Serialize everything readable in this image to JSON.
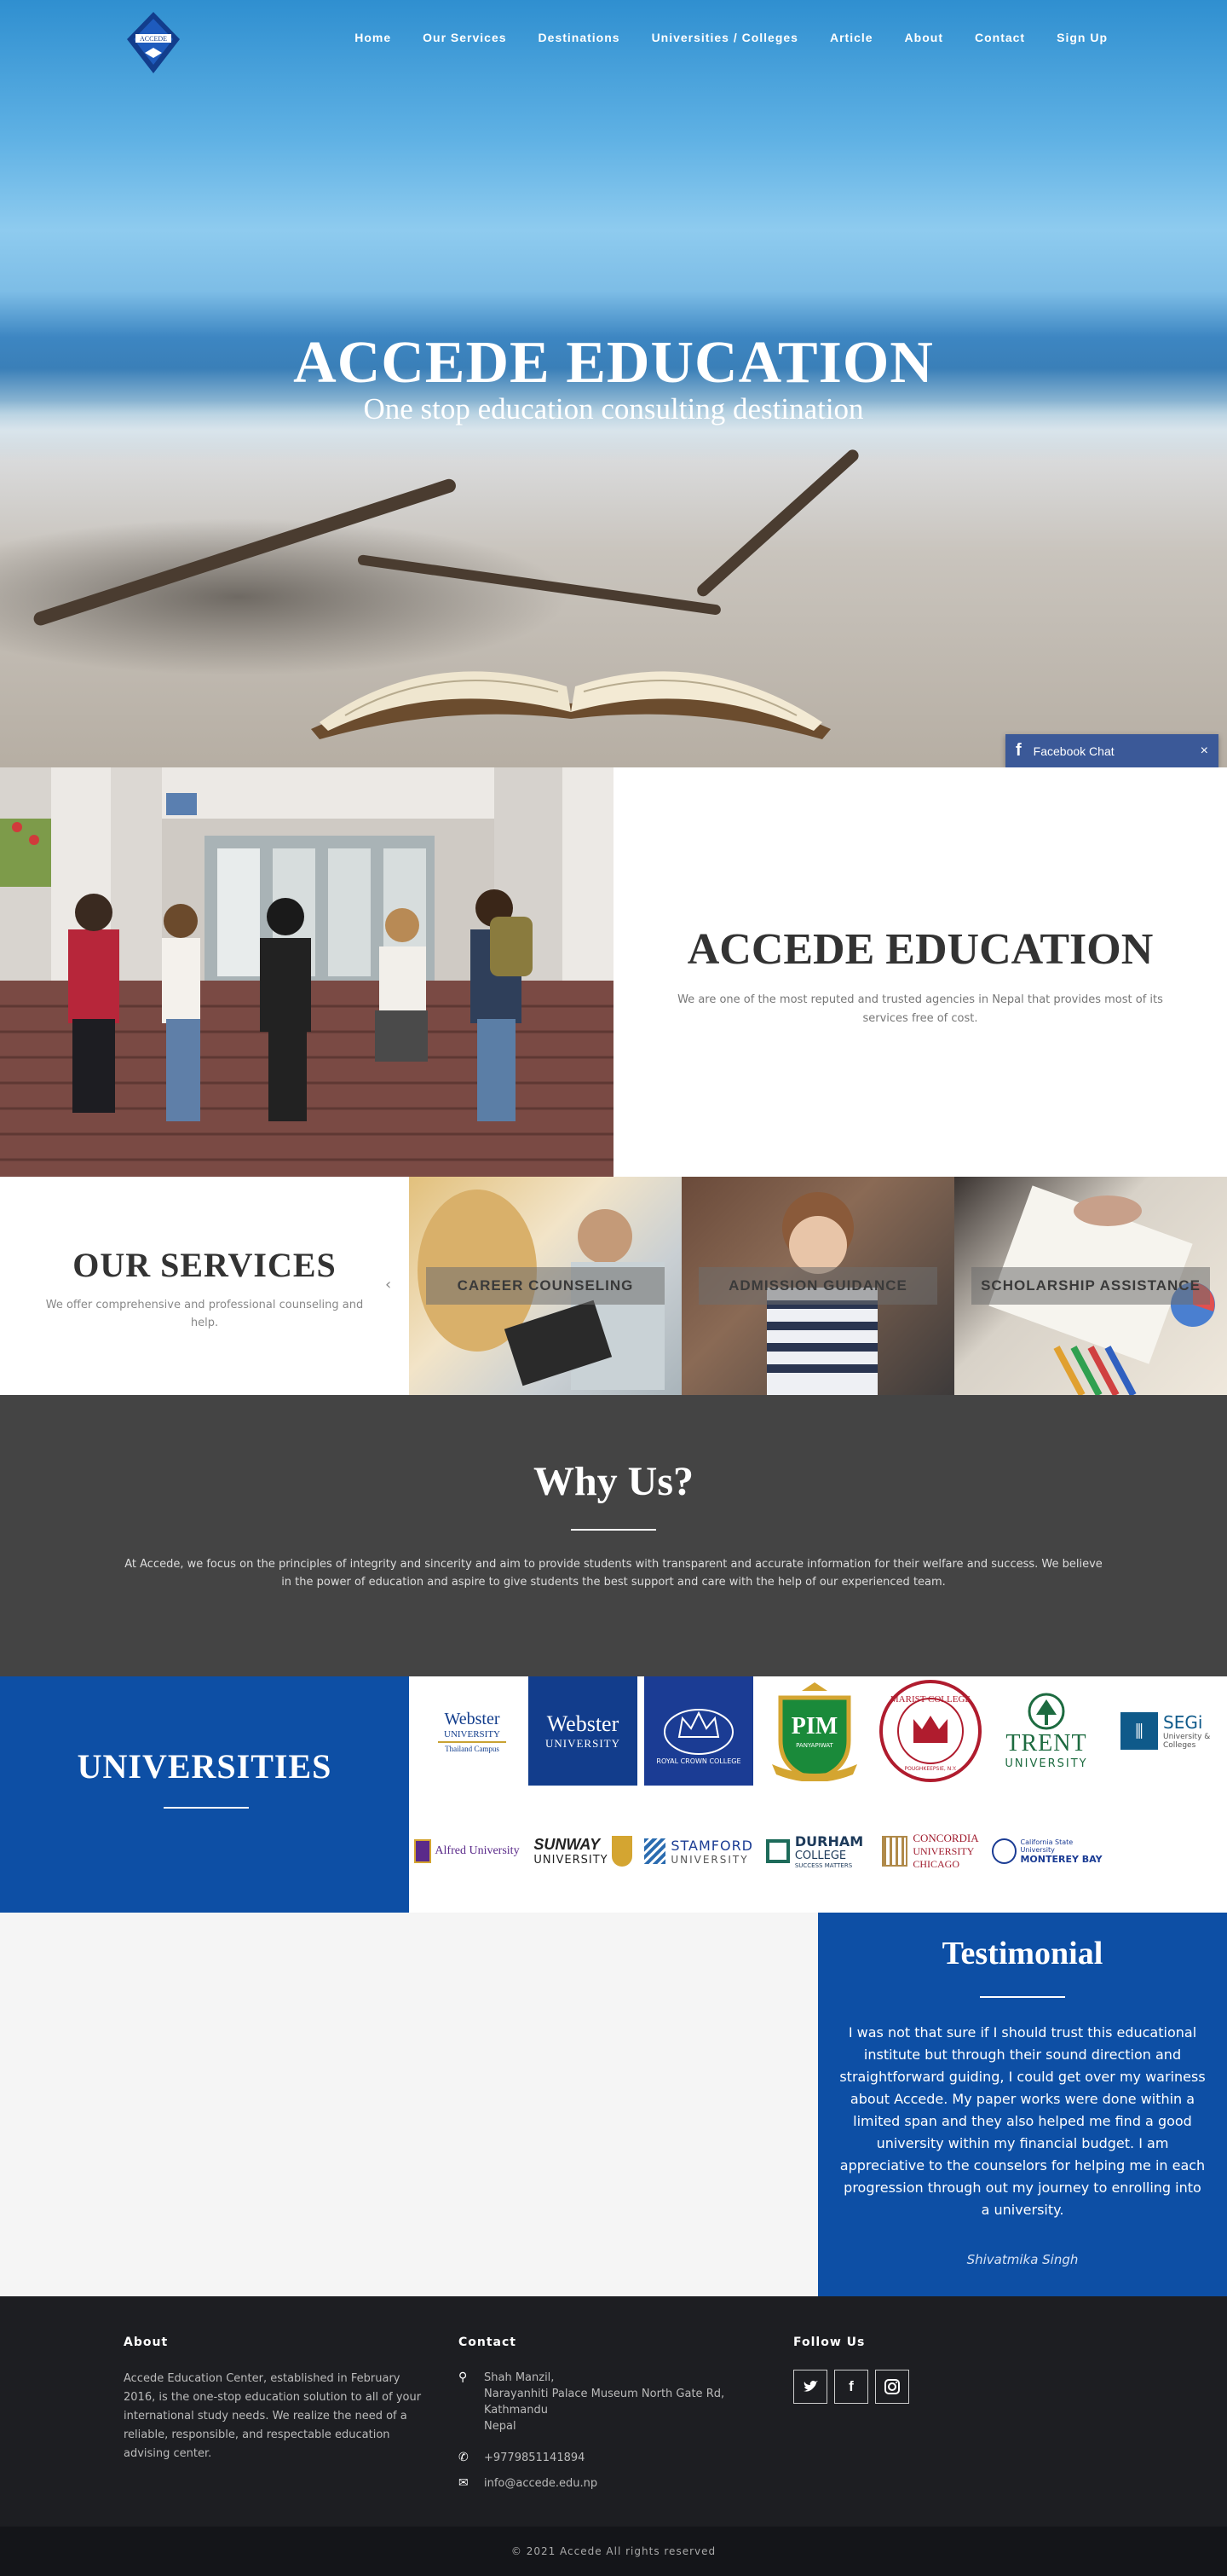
{
  "nav": {
    "logo_text": "ACCEDE",
    "items": [
      "Home",
      "Our Services",
      "Destinations",
      "Universities / Colleges",
      "Article",
      "About",
      "Contact",
      "Sign Up"
    ]
  },
  "hero": {
    "title": "ACCEDE EDUCATION",
    "subtitle": "One stop education consulting destination"
  },
  "fb_chat": {
    "label": "Facebook Chat",
    "close": "×"
  },
  "about": {
    "title": "ACCEDE EDUCATION",
    "description": "We are one of the most reputed and trusted agencies in Nepal that provides most of its services free of cost."
  },
  "services": {
    "title": "OUR SERVICES",
    "description": "We offer comprehensive and professional counseling and help.",
    "items": [
      "CAREER COUNSELING",
      "ADMISSION GUIDANCE",
      "SCHOLARSHIP ASSISTANCE"
    ]
  },
  "why": {
    "title": "Why Us?",
    "text": "At Accede, we focus on the principles of integrity and sincerity and aim to provide students with transparent and accurate information for their welfare and success. We believe in the power of education and aspire to give students the best support and care with the help of our experienced team."
  },
  "universities": {
    "title": "UNIVERSITIES",
    "logos": [
      {
        "line1": "Webster",
        "line2": "UNIVERSITY",
        "line3": "Thailand Campus"
      },
      {
        "line1": "Webster",
        "line2": "UNIVERSITY"
      },
      {
        "line1": "ROYAL CROWN COLLEGE"
      },
      {
        "line1": "PIM",
        "line2": "PANYAPIWAT"
      },
      {
        "line1": "MARIST COLLEGE",
        "line2": "POUGHKEEPSIE, N.Y."
      },
      {
        "line1": "TRENT",
        "line2": "UNIVERSITY"
      },
      {
        "line1": "SEGi",
        "line2": "University & Colleges"
      },
      {
        "line1": "Alfred University"
      },
      {
        "line1": "SUNWAY",
        "line2": "UNIVERSITY"
      },
      {
        "line1": "STAMFORD",
        "line2": "UNIVERSITY"
      },
      {
        "line1": "DURHAM",
        "line2": "COLLEGE",
        "line3": "SUCCESS MATTERS"
      },
      {
        "line1": "CONCORDIA",
        "line2": "UNIVERSITY",
        "line3": "CHICAGO"
      },
      {
        "line1": "California State University",
        "line2": "MONTEREY BAY"
      }
    ]
  },
  "testimonial": {
    "title": "Testimonial",
    "text": "I was not that sure if I should trust this educational institute but through their sound direction and straightforward guiding, I could get over my wariness about Accede. My paper works were done within a limited span and they also helped me find a good university within my financial budget. I am appreciative to the counselors for helping me in each progression through out my journey to enrolling into a university.",
    "author": "Shivatmika Singh"
  },
  "footer": {
    "about_heading": "About",
    "about_text": "Accede Education Center, established in February 2016, is the one-stop education solution to all of your international study needs. We realize the need of a reliable, responsible, and respectable education advising center.",
    "contact_heading": "Contact",
    "address": [
      "Shah Manzil,",
      "Narayanhiti Palace Museum North Gate Rd,",
      "Kathmandu",
      "Nepal"
    ],
    "phone": "+9779851141894",
    "email": "info@accede.edu.np",
    "follow_heading": "Follow Us",
    "copyright": "© 2021 Accede All rights reserved"
  }
}
